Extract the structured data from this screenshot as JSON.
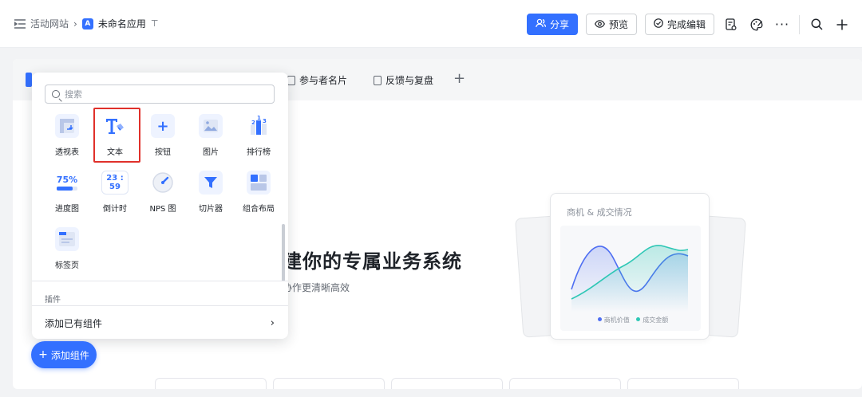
{
  "breadcrumb": {
    "site": "活动网站",
    "separator": "›",
    "app_name": "未命名应用",
    "app_badge": "A"
  },
  "toolbar": {
    "share_label": "分享",
    "preview_label": "预览",
    "finish_label": "完成编辑"
  },
  "page_tabs": [
    {
      "label": "参与者名片"
    },
    {
      "label": "反馈与复盘"
    }
  ],
  "hero": {
    "title": "建你的专属业务系统",
    "subtitle": "协作更清晰高效"
  },
  "illustration": {
    "title": "商机 & 成交情况",
    "legend": [
      "商机价值",
      "成交金额"
    ],
    "colors": [
      "#4e6ef2",
      "#2ec7b5"
    ]
  },
  "widget_panel": {
    "search_placeholder": "搜索",
    "widgets": [
      {
        "label": "透视表",
        "icon": "pivot-table-icon"
      },
      {
        "label": "文本",
        "icon": "text-icon"
      },
      {
        "label": "按钮",
        "icon": "button-plus-icon"
      },
      {
        "label": "图片",
        "icon": "image-icon"
      },
      {
        "label": "排行榜",
        "icon": "leaderboard-icon"
      },
      {
        "label": "进度图",
        "icon": "progress-icon"
      },
      {
        "label": "倒计时",
        "icon": "countdown-icon"
      },
      {
        "label": "NPS 图",
        "icon": "nps-gauge-icon"
      },
      {
        "label": "切片器",
        "icon": "filter-icon"
      },
      {
        "label": "组合布局",
        "icon": "layout-icon"
      },
      {
        "label": "标签页",
        "icon": "tabs-icon"
      }
    ],
    "progress_text": "75%",
    "countdown_text": "23 : 59",
    "section_label": "插件",
    "add_existing_label": "添加已有组件"
  },
  "add_widget_button": "添加组件",
  "colors": {
    "primary": "#3370ff",
    "highlight": "#e0302a"
  }
}
